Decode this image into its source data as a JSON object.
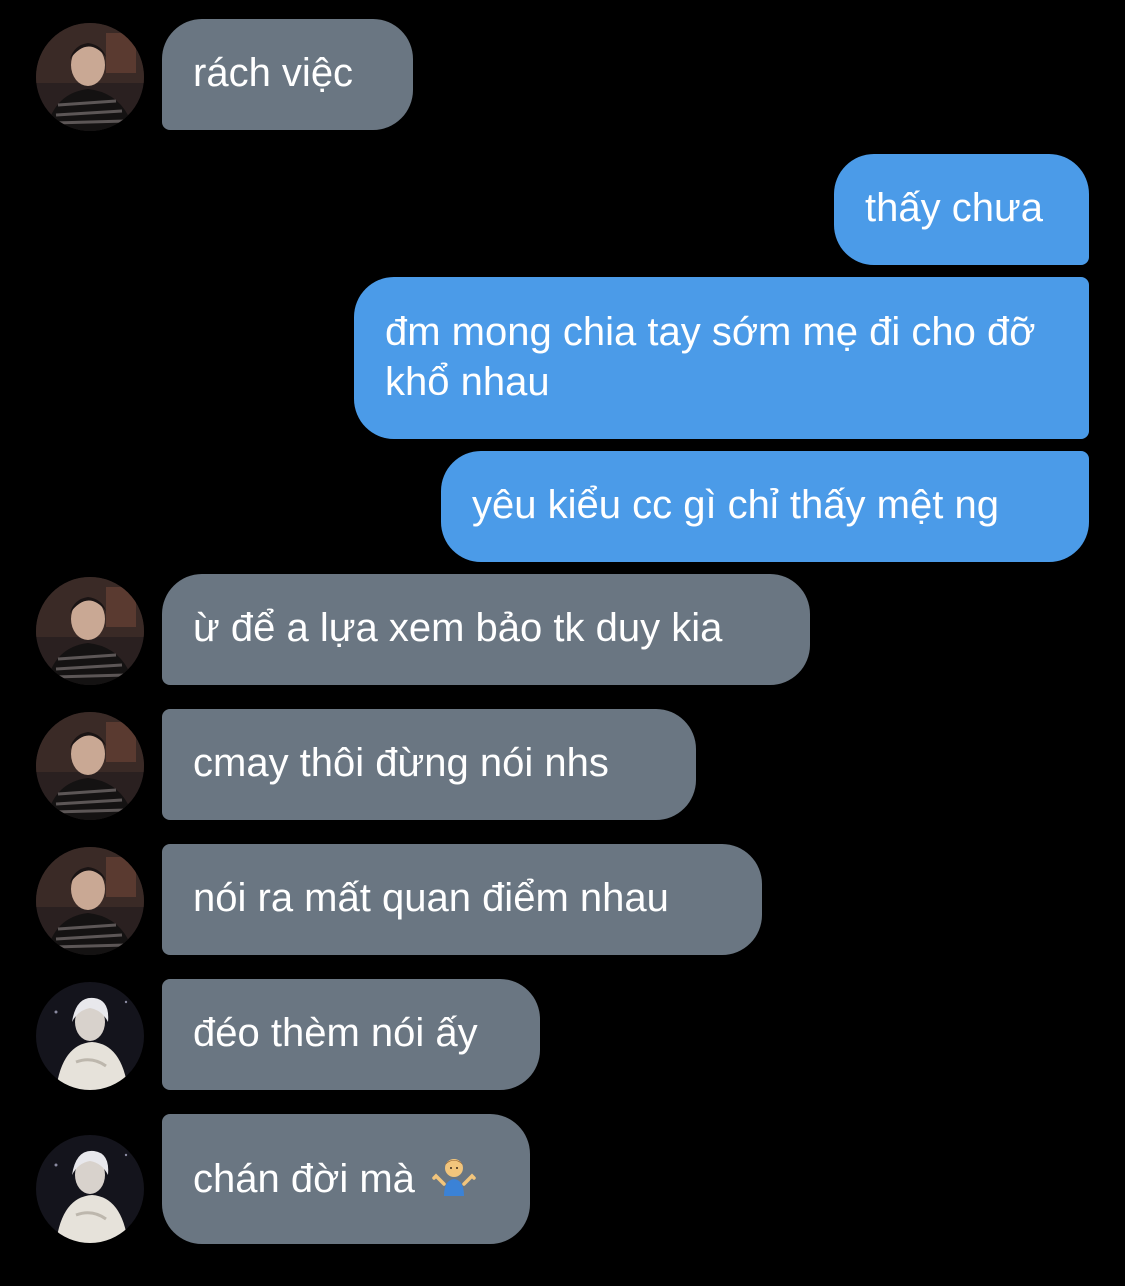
{
  "messages": [
    {
      "id": "m1",
      "side": "in",
      "sender": "contact_a",
      "text": "rách việc"
    },
    {
      "id": "m2",
      "side": "out",
      "text": "thấy chưa"
    },
    {
      "id": "m3",
      "side": "out",
      "text": "đm mong chia tay sớm mẹ đi cho đỡ khổ nhau"
    },
    {
      "id": "m4",
      "side": "out",
      "text": "yêu kiểu cc gì chỉ thấy mệt ng"
    },
    {
      "id": "m5",
      "side": "in",
      "sender": "contact_a",
      "text": "ừ để a lựa xem bảo tk duy kia"
    },
    {
      "id": "m6",
      "side": "in",
      "sender": "contact_a",
      "text": "cmay thôi đừng nói nhs"
    },
    {
      "id": "m7",
      "side": "in",
      "sender": "contact_a",
      "text": "nói ra mất quan điểm nhau"
    },
    {
      "id": "m8",
      "side": "in",
      "sender": "contact_b",
      "text": "đéo thèm nói ấy"
    },
    {
      "id": "m9",
      "side": "in",
      "sender": "contact_b",
      "text": "chán đời mà",
      "emoji": "man-shrugging-emoji"
    }
  ],
  "colors": {
    "background": "#000000",
    "incoming_bubble": "#6a7682",
    "outgoing_bubble": "#4b9be8",
    "text": "#ffffff"
  }
}
